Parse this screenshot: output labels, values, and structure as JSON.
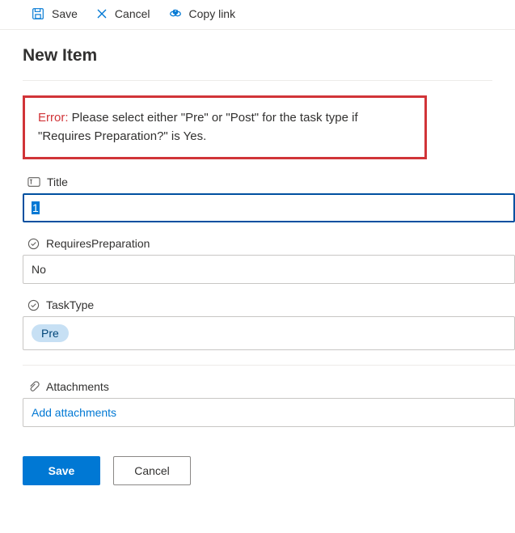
{
  "toolbar": {
    "save": "Save",
    "cancel": "Cancel",
    "copy_link": "Copy link"
  },
  "page_title": "New Item",
  "error": {
    "label": "Error:",
    "message": "Please select either \"Pre\" or \"Post\" for the task type if \"Requires Preparation?\" is Yes."
  },
  "fields": {
    "title": {
      "label": "Title",
      "value": "1"
    },
    "requires_preparation": {
      "label": "RequiresPreparation",
      "value": "No"
    },
    "task_type": {
      "label": "TaskType",
      "value": "Pre"
    },
    "attachments": {
      "label": "Attachments",
      "placeholder": "Add attachments"
    }
  },
  "buttons": {
    "save": "Save",
    "cancel": "Cancel"
  }
}
